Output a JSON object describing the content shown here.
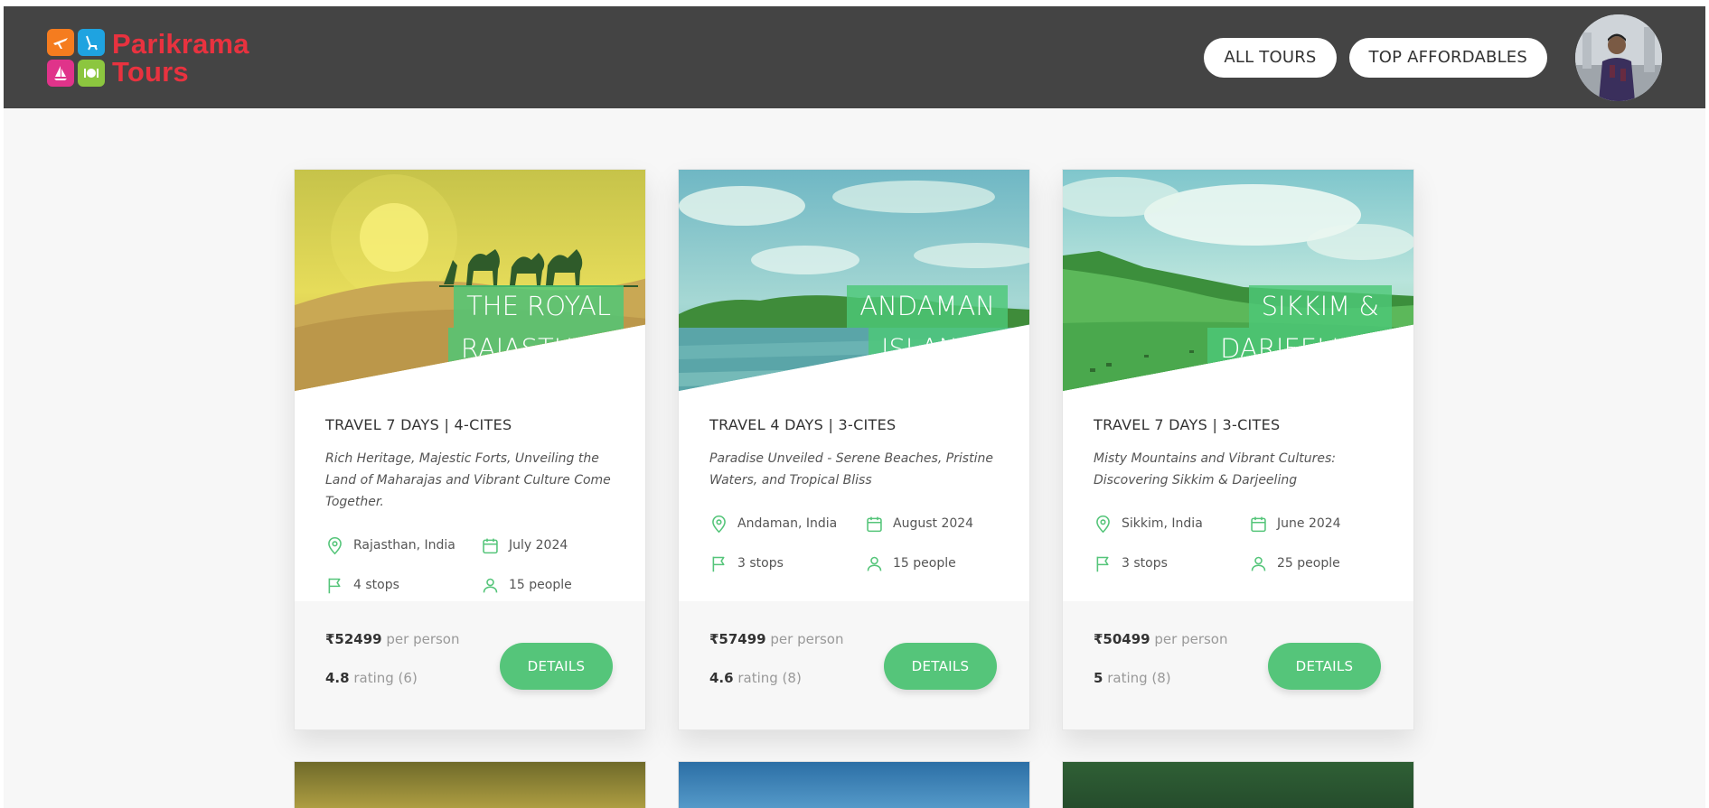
{
  "header": {
    "logo_line1": "Parikrama",
    "logo_line2": "Tours",
    "nav": [
      "ALL TOURS",
      "TOP AFFORDABLES"
    ],
    "colors": {
      "bar": "#444444",
      "brand_text": "#e8323f",
      "tiles": [
        "#f57c1f",
        "#1fa3e0",
        "#e0338a",
        "#8cc63f"
      ]
    }
  },
  "cards": [
    {
      "title_line1": "THE ROYAL",
      "title_line2": "RAJASTHAN",
      "subtitle": "TRAVEL 7 DAYS | 4-CITES",
      "description": "Rich Heritage, Majestic Forts, Unveiling the Land of Maharajas and Vibrant Culture Come Together.",
      "location": "Rajasthan, India",
      "date": "July 2024",
      "stops": "4 stops",
      "people": "15 people",
      "price": "₹52499",
      "price_suffix": " per person",
      "rating": "4.8",
      "rating_suffix": " rating (6)",
      "button": "DETAILS"
    },
    {
      "title_line1": "ANDAMAN",
      "title_line2": "ISLANDS",
      "subtitle": "TRAVEL 4 DAYS | 3-CITES",
      "description": "Paradise Unveiled - Serene Beaches, Pristine Waters, and Tropical Bliss",
      "location": "Andaman, India",
      "date": "August 2024",
      "stops": "3 stops",
      "people": "15 people",
      "price": "₹57499",
      "price_suffix": " per person",
      "rating": "4.6",
      "rating_suffix": " rating (8)",
      "button": "DETAILS"
    },
    {
      "title_line1": "SIKKIM &",
      "title_line2": "DARJEELING",
      "subtitle": "TRAVEL 7 DAYS | 3-CITES",
      "description": "Misty Mountains and Vibrant Cultures: Discovering Sikkim & Darjeeling",
      "location": "Sikkim, India",
      "date": "June 2024",
      "stops": "3 stops",
      "people": "25 people",
      "price": "₹50499",
      "price_suffix": " per person",
      "rating": "5",
      "rating_suffix": " rating (8)",
      "button": "DETAILS"
    }
  ],
  "accent": "#55c57a",
  "icons": [
    "map-pin-icon",
    "calendar-icon",
    "flag-icon",
    "user-icon"
  ]
}
